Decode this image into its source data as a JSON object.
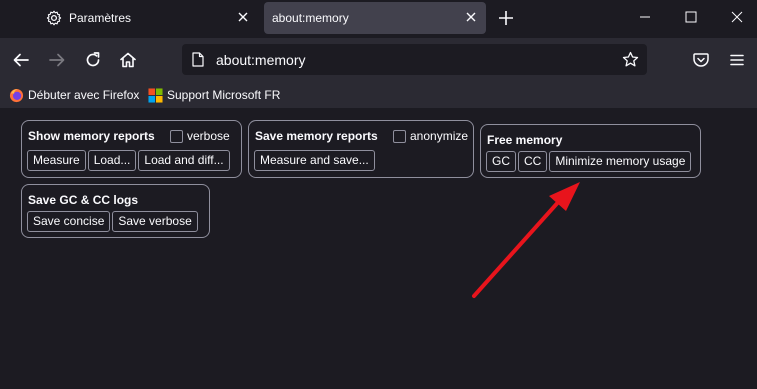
{
  "tabs": [
    {
      "title": "Paramètres",
      "icon": "gear-icon",
      "active": false
    },
    {
      "title": "about:memory",
      "active": true
    }
  ],
  "urlbar": {
    "url": "about:memory",
    "icon": "page-icon"
  },
  "bookmarks": [
    {
      "label": "Débuter avec Firefox",
      "icon": "firefox-icon"
    },
    {
      "label": "Support Microsoft FR",
      "icon": "microsoft-icon"
    }
  ],
  "memory": {
    "show_reports": {
      "title": "Show memory reports",
      "verbose_label": "verbose",
      "buttons": [
        "Measure",
        "Load...",
        "Load and diff..."
      ]
    },
    "save_reports": {
      "title": "Save memory reports",
      "anonymize_label": "anonymize",
      "buttons": [
        "Measure and save..."
      ]
    },
    "free_memory": {
      "title": "Free memory",
      "buttons": [
        "GC",
        "CC",
        "Minimize memory usage"
      ]
    },
    "gc_cc_logs": {
      "title": "Save GC & CC logs",
      "buttons": [
        "Save concise",
        "Save verbose"
      ]
    }
  },
  "colors": {
    "background": "#1c1b22",
    "toolbar": "#2b2a33",
    "active_tab": "#42414d",
    "border": "#8f8f9d",
    "annotation_arrow": "#e8141c"
  }
}
